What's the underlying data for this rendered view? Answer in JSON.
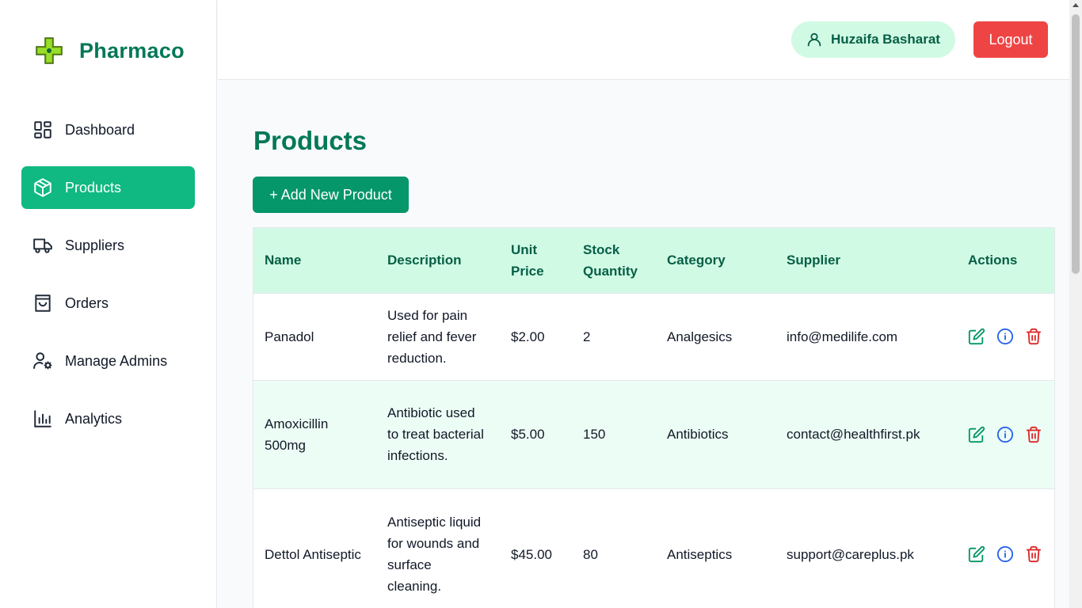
{
  "brand": {
    "name": "Pharmaco"
  },
  "sidebar": {
    "items": [
      {
        "label": "Dashboard",
        "icon": "dashboard-icon",
        "active": false
      },
      {
        "label": "Products",
        "icon": "box-icon",
        "active": true
      },
      {
        "label": "Suppliers",
        "icon": "truck-icon",
        "active": false
      },
      {
        "label": "Orders",
        "icon": "shopping-bag-icon",
        "active": false
      },
      {
        "label": "Manage Admins",
        "icon": "user-gear-icon",
        "active": false
      },
      {
        "label": "Analytics",
        "icon": "bar-chart-icon",
        "active": false
      }
    ]
  },
  "header": {
    "user_name": "Huzaifa Basharat",
    "logout_label": "Logout"
  },
  "main": {
    "title": "Products",
    "add_button_label": "+ Add New Product"
  },
  "table": {
    "columns": [
      "Name",
      "Description",
      "Unit Price",
      "Stock Quantity",
      "Category",
      "Supplier",
      "Actions"
    ],
    "rows": [
      {
        "name": "Panadol",
        "description": "Used for pain relief and fever reduction.",
        "unit_price": "$2.00",
        "stock": "2",
        "category": "Analgesics",
        "supplier": "info@medilife.com"
      },
      {
        "name": "Amoxicillin 500mg",
        "description": "Antibiotic used to treat bacterial infections.",
        "unit_price": "$5.00",
        "stock": "150",
        "category": "Antibiotics",
        "supplier": "contact@healthfirst.pk"
      },
      {
        "name": "Dettol Antiseptic",
        "description": "Antiseptic liquid for wounds and surface cleaning.",
        "unit_price": "$45.00",
        "stock": "80",
        "category": "Antiseptics",
        "supplier": "support@careplus.pk"
      }
    ]
  },
  "colors": {
    "brand_green": "#047857",
    "active_nav": "#10b981",
    "header_row": "#d1fae5",
    "logout_red": "#ef4444",
    "edit_green": "#059669",
    "info_blue": "#2563eb",
    "delete_red": "#dc2626"
  }
}
